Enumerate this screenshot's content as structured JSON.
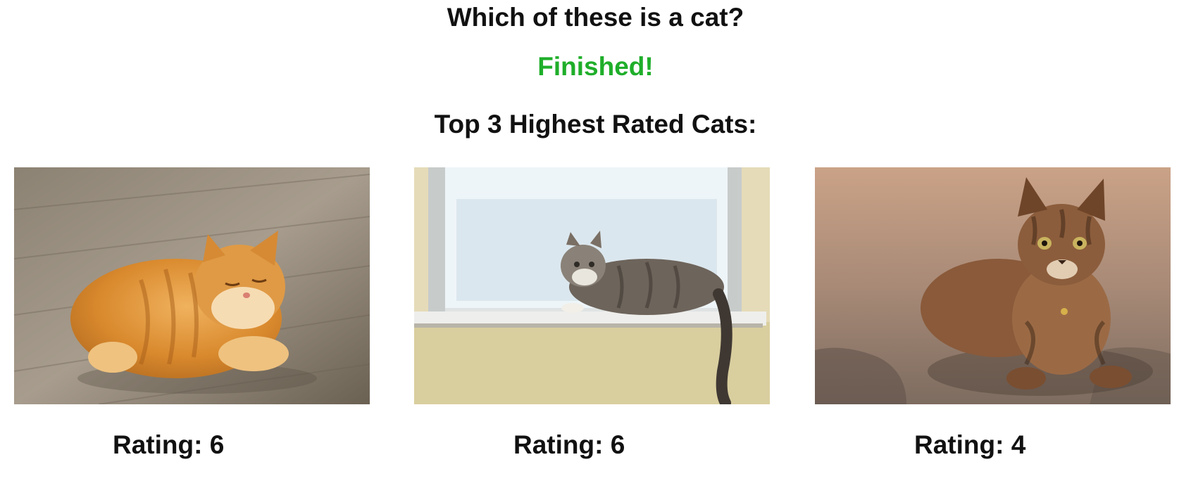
{
  "heading": {
    "title": "Which of these is a cat?",
    "status": "Finished!",
    "status_color": "#1fae2a",
    "subtitle": "Top 3 Highest Rated Cats:"
  },
  "top_cats": [
    {
      "rating_label": "Rating:",
      "rating": "6",
      "image": "orange-tabby-cat-on-wood-floor"
    },
    {
      "rating_label": "Rating:",
      "rating": "6",
      "image": "grey-tabby-cat-on-window-sill"
    },
    {
      "rating_label": "Rating:",
      "rating": "4",
      "image": "brown-tabby-kitten-on-ground"
    }
  ]
}
